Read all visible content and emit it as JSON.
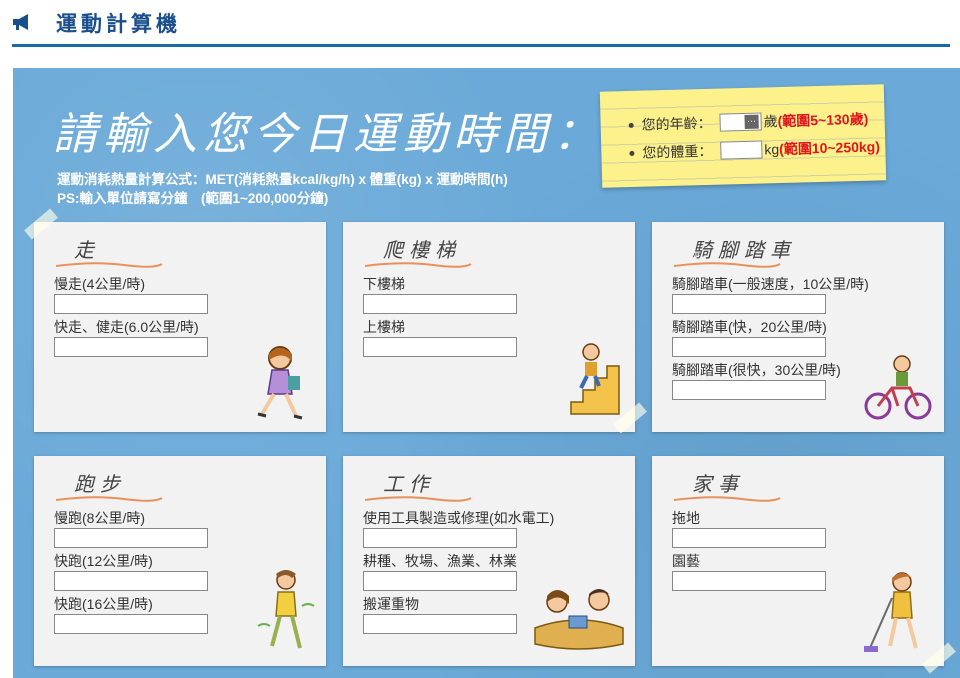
{
  "header": {
    "title": "運動計算機",
    "icon": "megaphone-icon"
  },
  "hero": {
    "title": "請輸入您今日運動時間：",
    "formula_line1": "運動消耗熱量計算公式：MET(消耗熱量kcal/kg/h) x 體重(kg) x 運動時間(h)",
    "formula_line2": "PS:輸入單位請寫分鐘　(範圍1~200,000分鐘)"
  },
  "note": {
    "age_label": "您的年齡：",
    "age_unit": "歲",
    "age_range": "(範圍5~130歲)",
    "weight_label": "您的體重：",
    "weight_unit": "kg",
    "weight_range": "(範圍10~250kg)"
  },
  "cards": [
    {
      "title": "走",
      "fields": [
        {
          "label": "慢走(4公里/時)"
        },
        {
          "label": "快走、健走(6.0公里/時)"
        }
      ]
    },
    {
      "title": "爬樓梯",
      "fields": [
        {
          "label": "下樓梯"
        },
        {
          "label": "上樓梯"
        }
      ]
    },
    {
      "title": "騎腳踏車",
      "fields": [
        {
          "label": "騎腳踏車(一般速度，10公里/時)"
        },
        {
          "label": "騎腳踏車(快，20公里/時)"
        },
        {
          "label": "騎腳踏車(很快，30公里/時)"
        }
      ]
    },
    {
      "title": "跑步",
      "fields": [
        {
          "label": "慢跑(8公里/時)"
        },
        {
          "label": "快跑(12公里/時)"
        },
        {
          "label": "快跑(16公里/時)"
        }
      ]
    },
    {
      "title": "工作",
      "fields": [
        {
          "label": "使用工具製造或修理(如水電工)"
        },
        {
          "label": "耕種、牧場、漁業、林業"
        },
        {
          "label": "搬運重物"
        }
      ]
    },
    {
      "title": "家事",
      "fields": [
        {
          "label": "拖地"
        },
        {
          "label": "園藝"
        }
      ]
    }
  ],
  "colors": {
    "board": "#6aa9d8",
    "title": "#1b4f8c",
    "range": "#e0161b",
    "note": "#fdf18c"
  }
}
